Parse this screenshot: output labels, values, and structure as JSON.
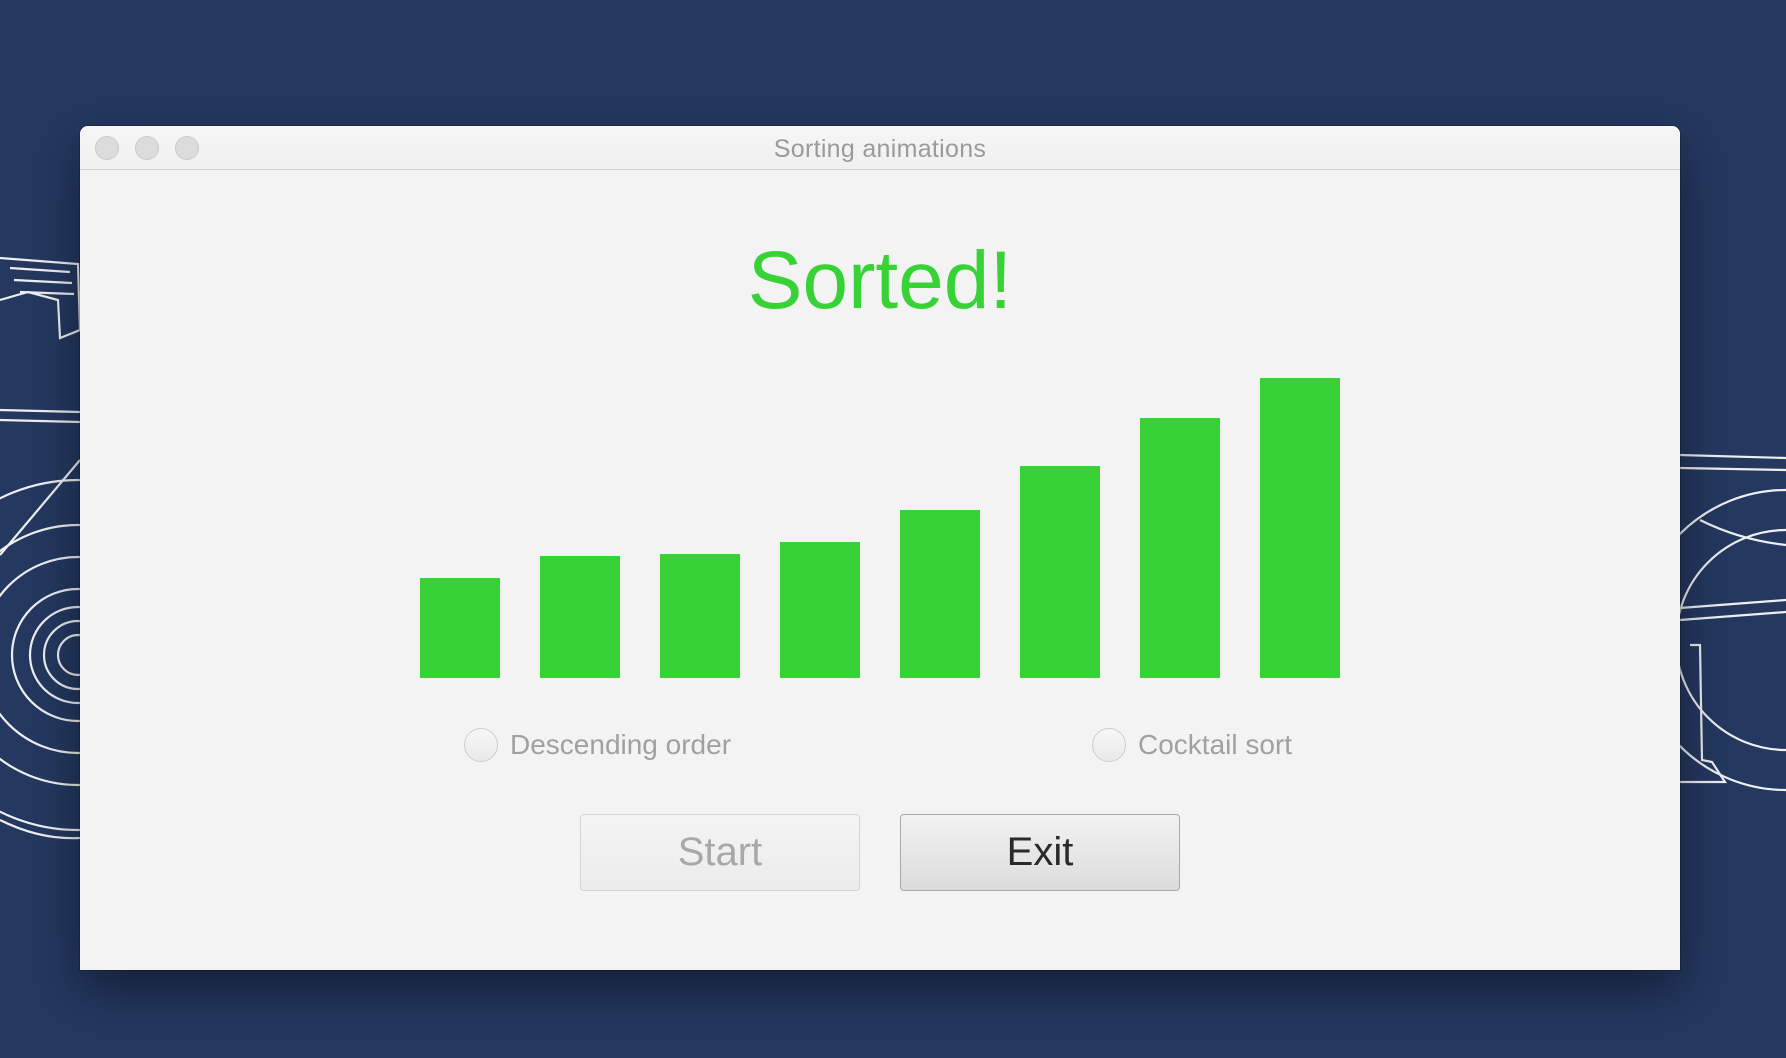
{
  "window": {
    "title": "Sorting animations"
  },
  "status": {
    "heading": "Sorted!"
  },
  "chart_data": {
    "type": "bar",
    "values": [
      100,
      122,
      124,
      136,
      168,
      212,
      260,
      300
    ],
    "color": "#37d336"
  },
  "options": {
    "descending_label": "Descending order",
    "descending_checked": false,
    "cocktail_label": "Cocktail sort",
    "cocktail_checked": false
  },
  "buttons": {
    "start_label": "Start",
    "start_enabled": false,
    "exit_label": "Exit"
  },
  "colors": {
    "desktop_bg": "#243860",
    "accent_green": "#37d336",
    "window_bg": "#f3f3f3"
  }
}
